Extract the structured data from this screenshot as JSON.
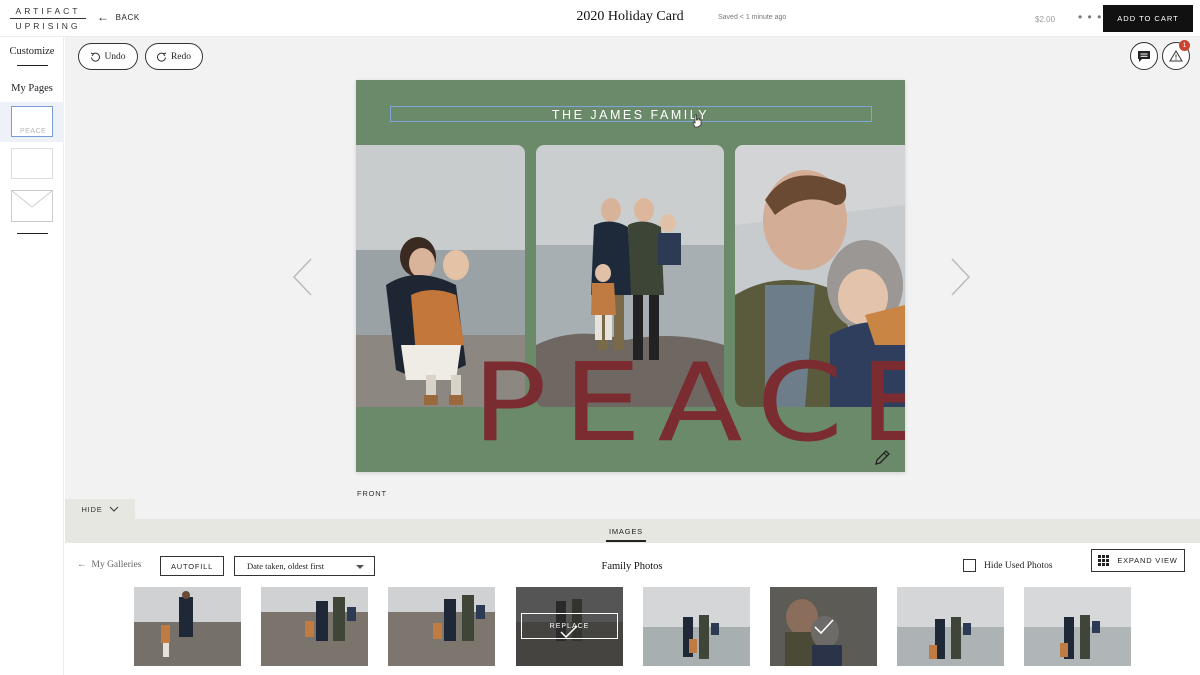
{
  "header": {
    "logo_top": "ARTIFACT",
    "logo_bottom": "UPRISING",
    "back_label": "BACK",
    "title": "2020 Holiday Card",
    "saved_status": "Saved < 1 minute ago",
    "price": "$2.00",
    "add_to_cart": "ADD TO CART"
  },
  "sidebar": {
    "customize": "Customize",
    "my_pages": "My Pages",
    "pages": [
      {
        "label": "PEACE",
        "active": true
      },
      {
        "label": "",
        "active": false
      },
      {
        "label": "",
        "active": false
      }
    ]
  },
  "toolbar": {
    "undo": "Undo",
    "redo": "Redo",
    "warning_count": "1"
  },
  "card": {
    "family_text": "THE JAMES FAMILY",
    "peace_text": "PEACE",
    "side_label": "FRONT",
    "background_color": "#6b8a6a",
    "accent_color": "#7a2c30"
  },
  "panel": {
    "hide_label": "HIDE",
    "images_tab": "IMAGES",
    "my_galleries": "My Galleries",
    "autofill": "AUTOFILL",
    "sort_value": "Date taken, oldest first",
    "gallery_title": "Family Photos",
    "hide_used": "Hide Used Photos",
    "expand_view": "EXPAND VIEW",
    "replace_label": "REPLACE"
  }
}
